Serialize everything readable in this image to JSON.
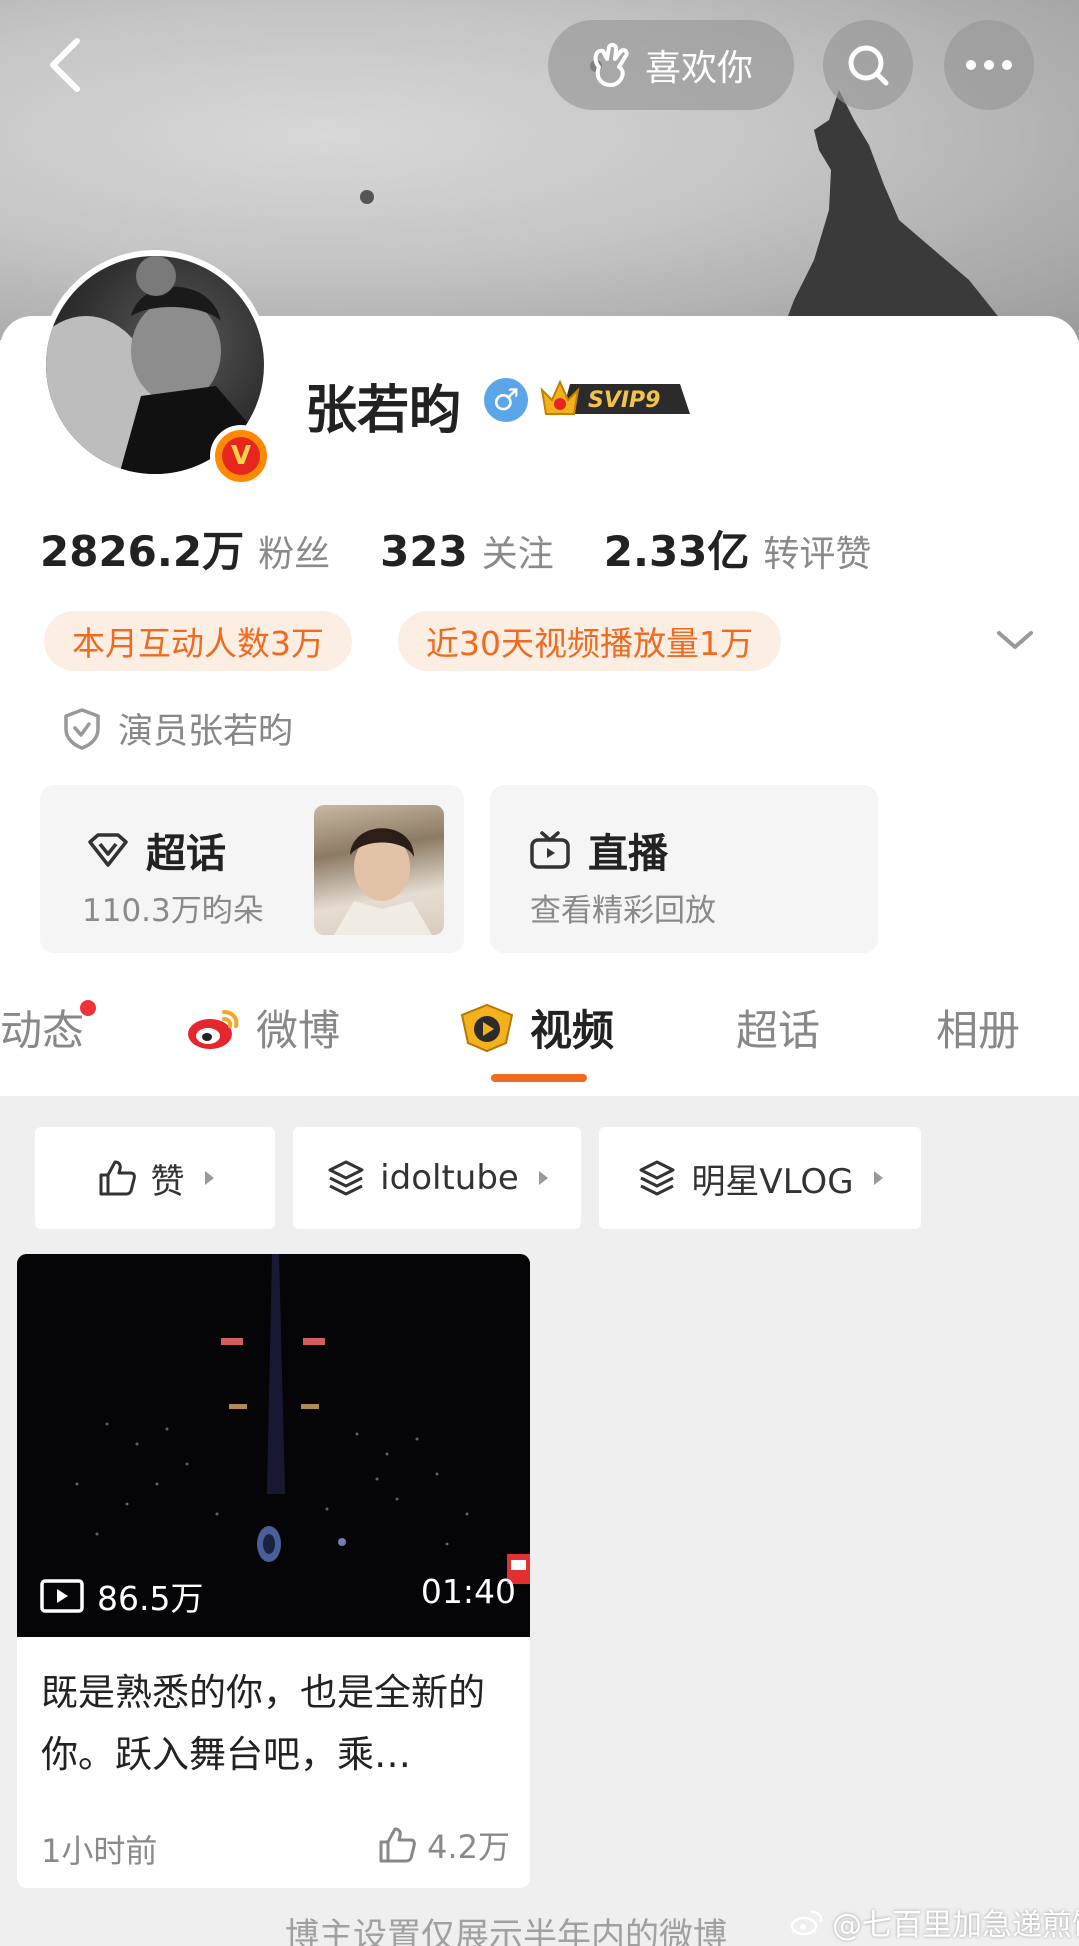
{
  "header": {
    "like_label": "喜欢你"
  },
  "profile": {
    "name": "张若昀",
    "gender_symbol": "♂",
    "vip_badge": "SVIP9",
    "stats": [
      {
        "value": "2826.2万",
        "label": "粉丝"
      },
      {
        "value": "323",
        "label": "关注"
      },
      {
        "value": "2.33亿",
        "label": "转评赞"
      }
    ],
    "tags": [
      "本月互动人数3万",
      "近30天视频播放量1万"
    ],
    "identity": "演员张若昀",
    "supertopic": {
      "title": "超话",
      "sub": "110.3万昀朵"
    },
    "live": {
      "title": "直播",
      "sub": "查看精彩回放"
    }
  },
  "tabs": {
    "items": [
      "动态",
      "微博",
      "视频",
      "超话",
      "相册"
    ],
    "active": "视频"
  },
  "filters": [
    "赞",
    "idoltube",
    "明星VLOG"
  ],
  "video": {
    "views": "86.5万",
    "duration": "01:40",
    "title": "既是熟悉的你，也是全新的你。跃入舞台吧，乘…",
    "time_ago": "1小时前",
    "likes": "4.2万"
  },
  "footer_note": "博主设置仅展示半年内的微博",
  "watermark": "@七百里加急递煎饼",
  "colors": {
    "accent": "#f06a1f",
    "tag_bg": "#fdeee4",
    "muted_text": "#8a8a8a",
    "notification_dot": "#f0323a"
  }
}
